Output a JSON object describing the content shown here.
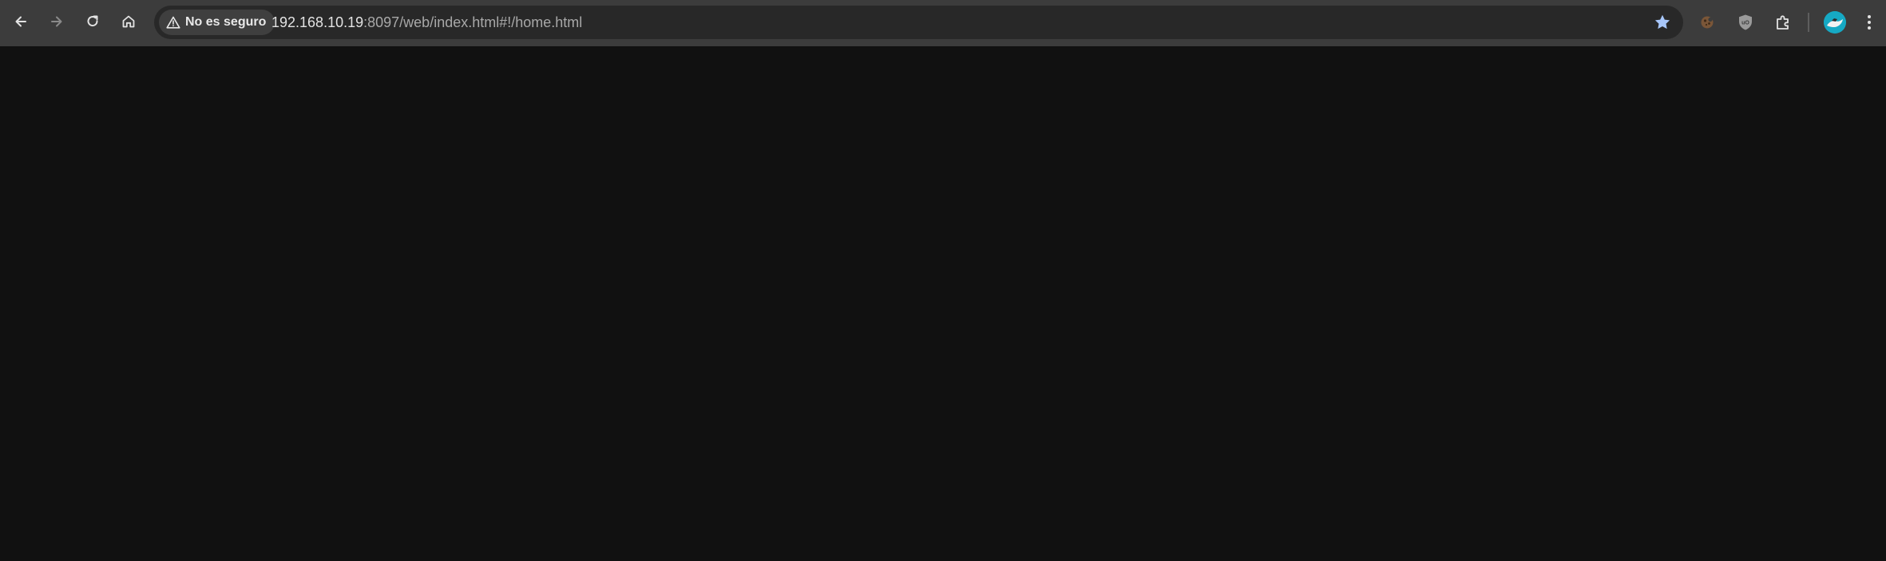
{
  "toolbar": {
    "nav_icons": [
      "back-icon",
      "forward-icon",
      "reload-icon",
      "home-icon"
    ],
    "security": {
      "label": "No es seguro",
      "icon": "warning-triangle-icon"
    },
    "url": {
      "host": "192.168.10.19",
      "rest": ":8097/web/index.html#!/home.html"
    },
    "bookmark_icon": "star-filled-icon",
    "extensions": [
      "cookie-extension-icon",
      "ublock-shield-icon",
      "puzzle-extensions-icon"
    ],
    "profile_icon": "profile-avatar",
    "menu_icon": "kebab-menu-icon"
  },
  "colors": {
    "toolbar_bg": "#3c3c3c",
    "omnibox_bg": "#282828",
    "page_bg": "#111111",
    "star": "#a8c7fa",
    "avatar": "#16a9c4"
  }
}
